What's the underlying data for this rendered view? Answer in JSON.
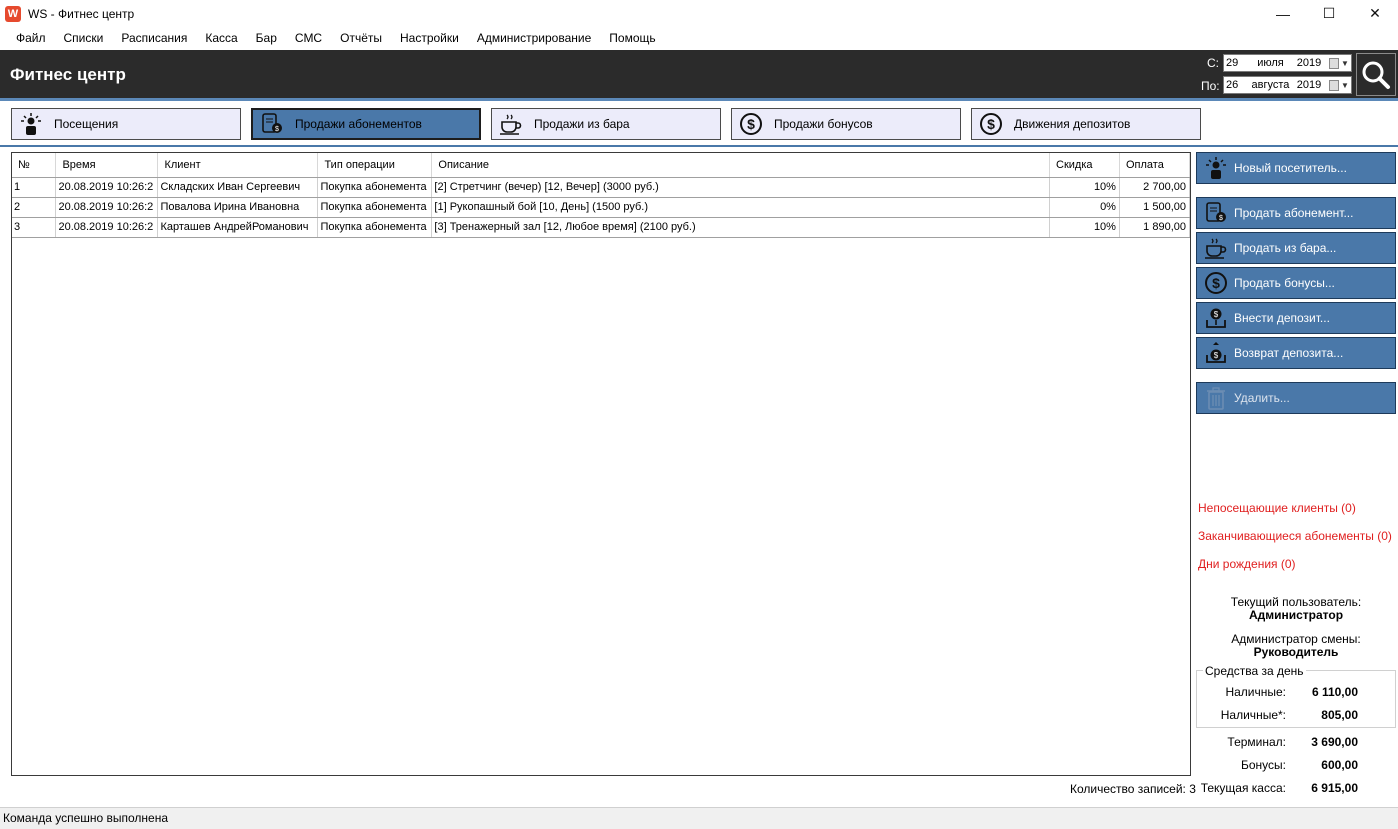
{
  "window": {
    "title": "WS - Фитнес центр",
    "app_icon_letter": "W",
    "minimize": "—",
    "maximize": "☐",
    "close": "✕"
  },
  "menu": [
    "Файл",
    "Списки",
    "Расписания",
    "Касса",
    "Бар",
    "СМС",
    "Отчёты",
    "Настройки",
    "Администрирование",
    "Помощь"
  ],
  "header": {
    "title": "Фитнес центр",
    "from_label": "С:",
    "to_label": "По:",
    "from_date": {
      "day": "29",
      "month": "июля",
      "year": "2019"
    },
    "to_date": {
      "day": "26",
      "month": "августа",
      "year": "2019"
    }
  },
  "tabs": [
    {
      "label": "Посещения",
      "icon": "visitor-icon",
      "active": false
    },
    {
      "label": "Продажи абонементов",
      "icon": "card-icon",
      "active": true
    },
    {
      "label": "Продажи из бара",
      "icon": "cup-icon",
      "active": false
    },
    {
      "label": "Продажи бонусов",
      "icon": "dollar-icon",
      "active": false
    },
    {
      "label": "Движения депозитов",
      "icon": "dollar-icon",
      "active": false
    }
  ],
  "table": {
    "columns": [
      "№",
      "Время",
      "Клиент",
      "Тип операции",
      "Описание",
      "Скидка",
      "Оплата"
    ],
    "rows": [
      [
        "1",
        "20.08.2019 10:26:2",
        "Складских Иван Сергеевич",
        "Покупка абонемента",
        "[2] Стретчинг (вечер) [12, Вечер] (3000 руб.)",
        "10%",
        "2 700,00"
      ],
      [
        "2",
        "20.08.2019 10:26:2",
        "Повалова Ирина Ивановна",
        "Покупка абонемента",
        "[1] Рукопашный бой [10, День] (1500 руб.)",
        "0%",
        "1 500,00"
      ],
      [
        "3",
        "20.08.2019 10:26:2",
        "Карташев АндрейРоманович",
        "Покупка абонемента",
        "[3] Тренажерный зал [12, Любое время] (2100 руб.)",
        "10%",
        "1 890,00"
      ]
    ]
  },
  "records_count": "Количество записей: 3",
  "status": "Команда успешно выполнена",
  "side": {
    "new_visitor": "Новый посетитель...",
    "sell_subscription": "Продать абонемент...",
    "sell_bar": "Продать из бара...",
    "sell_bonus": "Продать бонусы...",
    "deposit_in": "Внести депозит...",
    "deposit_return": "Возврат депозита...",
    "delete": "Удалить..."
  },
  "alerts": {
    "no_visit": "Непосещающие клиенты (0)",
    "expiring": "Заканчивающиеся абонементы (0)",
    "birthdays": "Дни рождения (0)"
  },
  "user": {
    "current_label": "Текущий пользователь:",
    "current_value": "Администратор",
    "shift_label": "Администратор смены:",
    "shift_value": "Руководитель"
  },
  "funds": {
    "legend": "Средства за день",
    "cash_label": "Наличные:",
    "cash_value": "6 110,00",
    "cash2_label": "Наличные*:",
    "cash2_value": "805,00",
    "terminal_label": "Терминал:",
    "terminal_value": "3 690,00",
    "bonus_label": "Бонусы:",
    "bonus_value": "600,00",
    "till_label": "Текущая касса:",
    "till_value": "6 915,00"
  }
}
